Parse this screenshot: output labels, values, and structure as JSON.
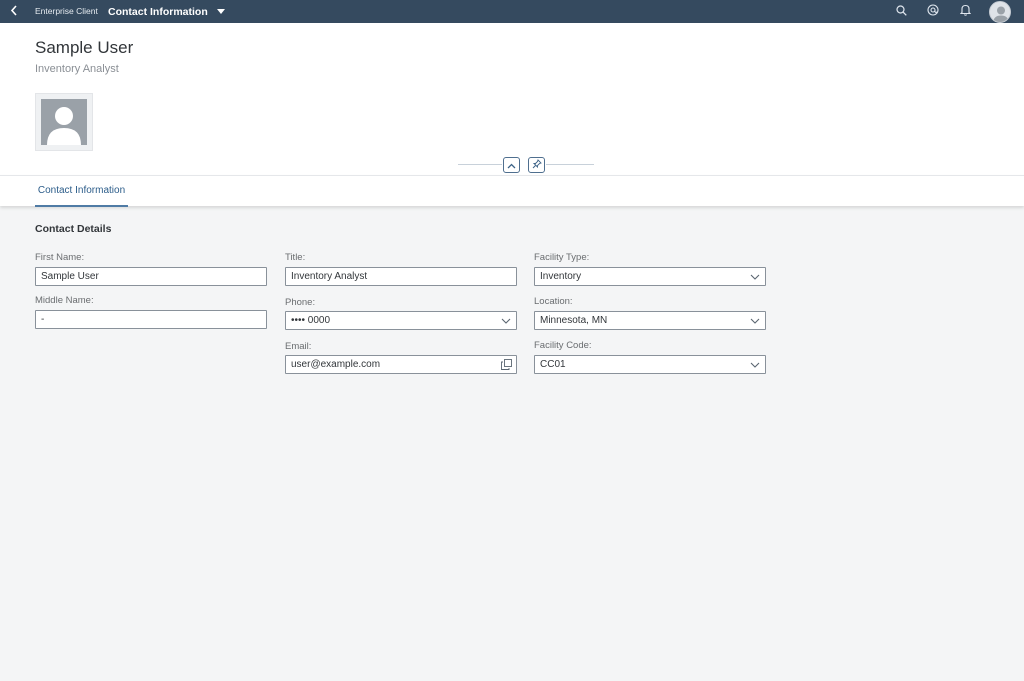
{
  "shell": {
    "brand": "Enterprise Client",
    "title": "Contact Information",
    "icons": [
      "back-icon",
      "search-icon",
      "at-icon",
      "bell-icon",
      "user-avatar"
    ]
  },
  "header": {
    "name": "Sample User",
    "role": "Inventory Analyst"
  },
  "tabs": [
    {
      "label": "Contact Information",
      "selected": true
    }
  ],
  "section": {
    "title": "Contact Details"
  },
  "fields": {
    "first_name": {
      "label": "First Name:",
      "value": "Sample User"
    },
    "middle_name": {
      "label": "Middle Name:",
      "value": "-"
    },
    "title": {
      "label": "Title:",
      "value": "Inventory Analyst"
    },
    "phone": {
      "label": "Phone:",
      "value": "•••• 0000"
    },
    "email": {
      "label": "Email:",
      "value": "user@example.com"
    },
    "facility_type": {
      "label": "Facility Type:",
      "value": "Inventory"
    },
    "location": {
      "label": "Location:",
      "value": "Minnesota, MN"
    },
    "facility_code": {
      "label": "Facility Code:",
      "value": "CC01"
    }
  },
  "colors": {
    "shell_bg": "#354a5f",
    "accent": "#4f7ba5",
    "page_bg": "#f4f5f6"
  }
}
